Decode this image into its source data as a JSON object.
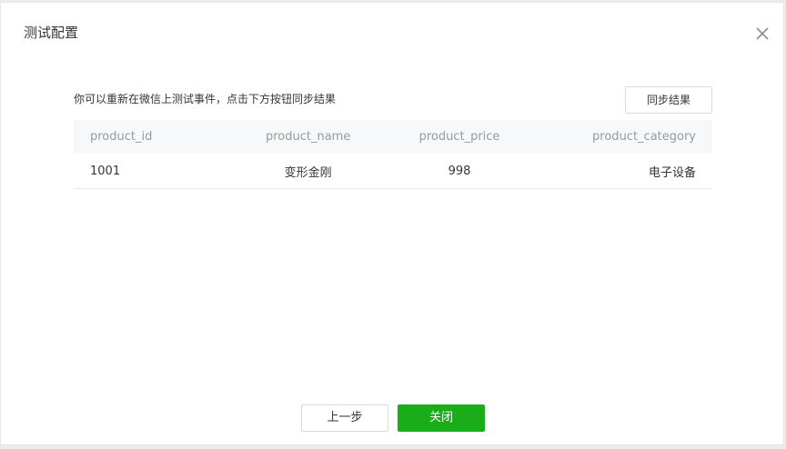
{
  "dialog": {
    "title": "测试配置",
    "close_icon": "close-icon"
  },
  "content": {
    "info_text": "你可以重新在微信上测试事件，点击下方按钮同步结果",
    "sync_button_label": "同步结果"
  },
  "table": {
    "columns": [
      "product_id",
      "product_name",
      "product_price",
      "product_category"
    ],
    "rows": [
      [
        "1001",
        "变形金刚",
        "998",
        "电子设备"
      ]
    ]
  },
  "footer": {
    "prev_button_label": "上一步",
    "close_button_label": "关闭"
  },
  "colors": {
    "primary_green": "#1aad19",
    "header_bg": "#f6f8f9",
    "header_text": "#9a9a9a",
    "body_text": "#353535"
  }
}
